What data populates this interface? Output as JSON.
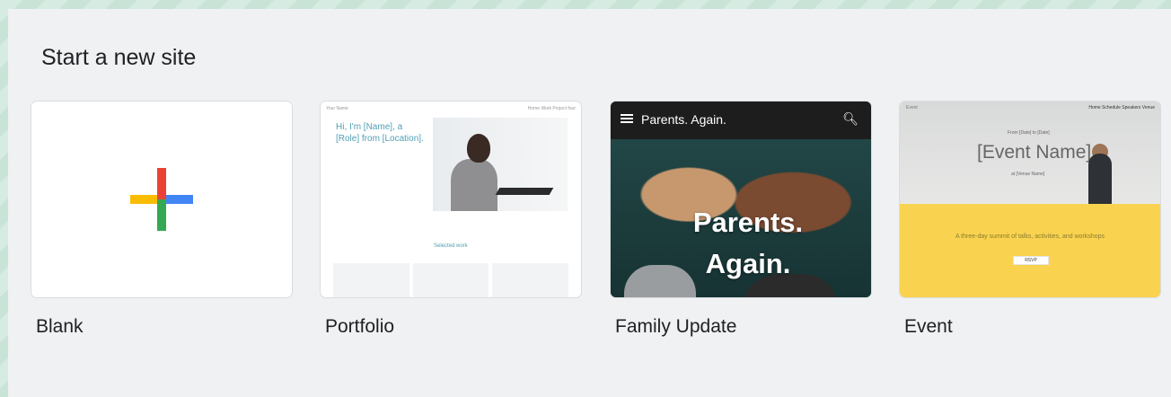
{
  "page": {
    "title": "Start a new site"
  },
  "templates": [
    {
      "label": "Blank"
    },
    {
      "label": "Portfolio",
      "preview": {
        "nav_left": "Your Name",
        "nav_right": "Home   Work   Project four",
        "hero": "Hi, I'm [Name], a [Role] from [Location].",
        "section": "Selected work"
      }
    },
    {
      "label": "Family Update",
      "preview": {
        "brand": "Parents. Again.",
        "title": "Parents. Again."
      }
    },
    {
      "label": "Event",
      "preview": {
        "nav_left": "Event",
        "nav_right": "Home  Schedule  Speakers  Venue",
        "date": "From [Date] to [Date]",
        "name": "[Event Name]",
        "venue": "at [Venue Name]",
        "description": "A three-day summit of talks, activities, and workshops",
        "button": "RSVP"
      }
    }
  ],
  "colors": {
    "google_red": "#ea4335",
    "google_blue": "#4285f4",
    "google_yellow": "#fbbc04",
    "google_green": "#34a853",
    "event_yellow": "#f9d34f",
    "portfolio_accent": "#4f9fb5"
  },
  "icons": {
    "blank_card": "plus-icon",
    "family_menu": "menu-icon",
    "family_search": "search-icon"
  }
}
